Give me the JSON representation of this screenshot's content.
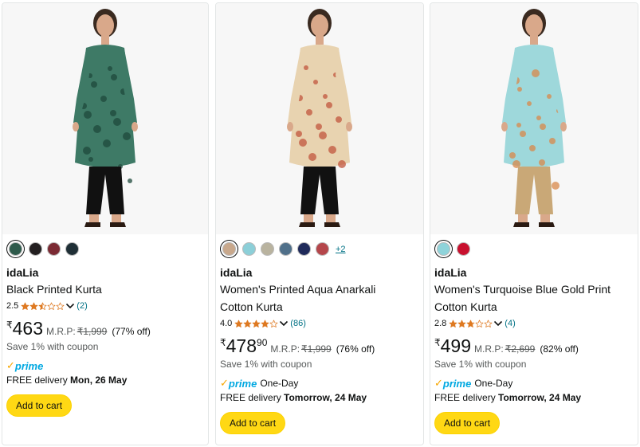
{
  "products": [
    {
      "brand": "idaLia",
      "title_line1": "Black Printed Kurta",
      "title_line2": "",
      "rating": "2.5",
      "rating_value": 2.5,
      "review_count": "(2)",
      "currency": "₹",
      "price_whole": "463",
      "price_fraction": "",
      "mrp_label": "M.R.P:",
      "mrp_value": "₹1,999",
      "discount": "(77% off)",
      "coupon": "Save 1% with coupon",
      "prime_label": "prime",
      "prime_extra": "",
      "delivery_prefix": "FREE delivery ",
      "delivery_date": "Mon, 26 May",
      "add_to_cart": "Add to cart",
      "swatches": [
        "#2E5A4B",
        "#231F20",
        "#7B2A33",
        "#1F2F36"
      ],
      "more_colors": "",
      "image_colors": {
        "kurta": "#3E7A66",
        "pattern": "#1F4A3C",
        "pants": "#111111",
        "skin": "#D9A88A"
      }
    },
    {
      "brand": "idaLia",
      "title_line1": "Women's Printed Aqua Anarkali",
      "title_line2": "Cotton Kurta",
      "rating": "4.0",
      "rating_value": 4.0,
      "review_count": "(86)",
      "currency": "₹",
      "price_whole": "478",
      "price_fraction": "90",
      "mrp_label": "M.R.P:",
      "mrp_value": "₹1,999",
      "discount": "(76% off)",
      "coupon": "Save 1% with coupon",
      "prime_label": "prime",
      "prime_extra": "One-Day",
      "delivery_prefix": "FREE delivery ",
      "delivery_date": "Tomorrow, 24 May",
      "add_to_cart": "Add to cart",
      "swatches": [
        "#C8A88C",
        "#8CCFD8",
        "#B9B39F",
        "#50708A",
        "#1F2A5A",
        "#B5464B"
      ],
      "more_colors": "+2",
      "image_colors": {
        "kurta": "#E8D3B0",
        "pattern": "#C2553E",
        "pants": "#111111",
        "skin": "#D9A88A"
      }
    },
    {
      "brand": "idaLia",
      "title_line1": "Women's Turquoise Blue Gold Print",
      "title_line2": "Cotton Kurta",
      "rating": "2.8",
      "rating_value": 2.8,
      "review_count": "(4)",
      "currency": "₹",
      "price_whole": "499",
      "price_fraction": "",
      "mrp_label": "M.R.P:",
      "mrp_value": "₹2,699",
      "discount": "(82% off)",
      "coupon": "Save 1% with coupon",
      "prime_label": "prime",
      "prime_extra": "One-Day",
      "delivery_prefix": "FREE delivery ",
      "delivery_date": "Tomorrow, 24 May",
      "add_to_cart": "Add to cart",
      "swatches": [
        "#8ED3DA",
        "#C8102E"
      ],
      "more_colors": "",
      "image_colors": {
        "kurta": "#9ED8DB",
        "pattern": "#D8884A",
        "pants": "#C9A877",
        "skin": "#D9A88A"
      }
    }
  ],
  "colors": {
    "star": "#DE7921",
    "link": "#007185",
    "button": "#FFD814",
    "prime": "#00A8E1"
  }
}
